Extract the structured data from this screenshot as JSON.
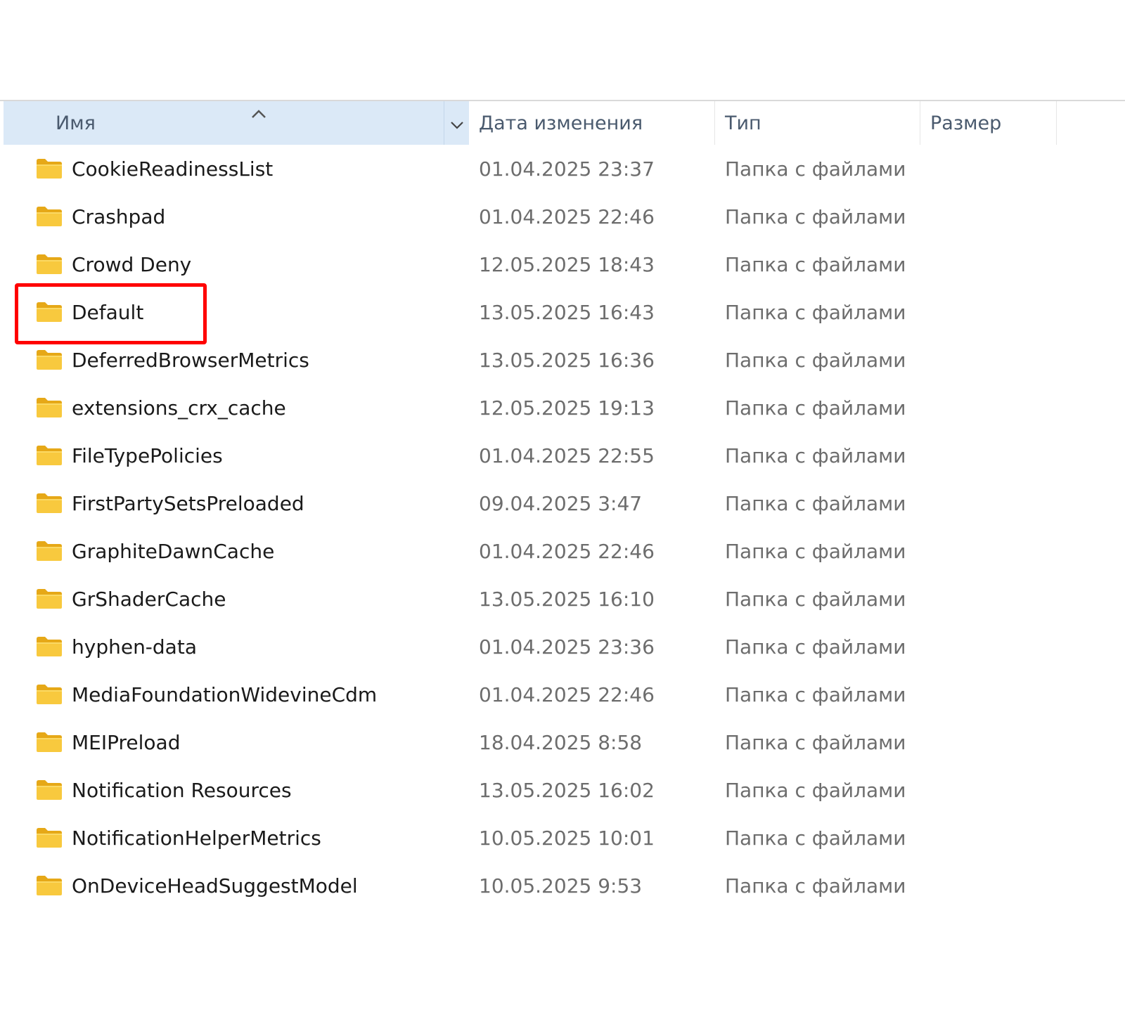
{
  "columns": {
    "name": "Имя",
    "date": "Дата изменения",
    "type": "Тип",
    "size": "Размер"
  },
  "icons": {
    "folder": "folder-icon",
    "sort": "sort-ascending-icon",
    "dropdown": "chevron-down-icon"
  },
  "colors": {
    "header_highlight": "#dbe9f7",
    "folder": "#f6c343",
    "annotation": "#ff0000"
  },
  "rows": [
    {
      "name": "CookieReadinessList",
      "date": "01.04.2025 23:37",
      "type": "Папка с файлами",
      "size": ""
    },
    {
      "name": "Crashpad",
      "date": "01.04.2025 22:46",
      "type": "Папка с файлами",
      "size": ""
    },
    {
      "name": "Crowd Deny",
      "date": "12.05.2025 18:43",
      "type": "Папка с файлами",
      "size": ""
    },
    {
      "name": "Default",
      "date": "13.05.2025 16:43",
      "type": "Папка с файлами",
      "size": ""
    },
    {
      "name": "DeferredBrowserMetrics",
      "date": "13.05.2025 16:36",
      "type": "Папка с файлами",
      "size": ""
    },
    {
      "name": "extensions_crx_cache",
      "date": "12.05.2025 19:13",
      "type": "Папка с файлами",
      "size": ""
    },
    {
      "name": "FileTypePolicies",
      "date": "01.04.2025 22:55",
      "type": "Папка с файлами",
      "size": ""
    },
    {
      "name": "FirstPartySetsPreloaded",
      "date": "09.04.2025 3:47",
      "type": "Папка с файлами",
      "size": ""
    },
    {
      "name": "GraphiteDawnCache",
      "date": "01.04.2025 22:46",
      "type": "Папка с файлами",
      "size": ""
    },
    {
      "name": "GrShaderCache",
      "date": "13.05.2025 16:10",
      "type": "Папка с файлами",
      "size": ""
    },
    {
      "name": "hyphen-data",
      "date": "01.04.2025 23:36",
      "type": "Папка с файлами",
      "size": ""
    },
    {
      "name": "MediaFoundationWidevineCdm",
      "date": "01.04.2025 22:46",
      "type": "Папка с файлами",
      "size": ""
    },
    {
      "name": "MEIPreload",
      "date": "18.04.2025 8:58",
      "type": "Папка с файлами",
      "size": ""
    },
    {
      "name": "Notification Resources",
      "date": "13.05.2025 16:02",
      "type": "Папка с файлами",
      "size": ""
    },
    {
      "name": "NotificationHelperMetrics",
      "date": "10.05.2025 10:01",
      "type": "Папка с файлами",
      "size": ""
    },
    {
      "name": "OnDeviceHeadSuggestModel",
      "date": "10.05.2025 9:53",
      "type": "Папка с файлами",
      "size": ""
    }
  ]
}
